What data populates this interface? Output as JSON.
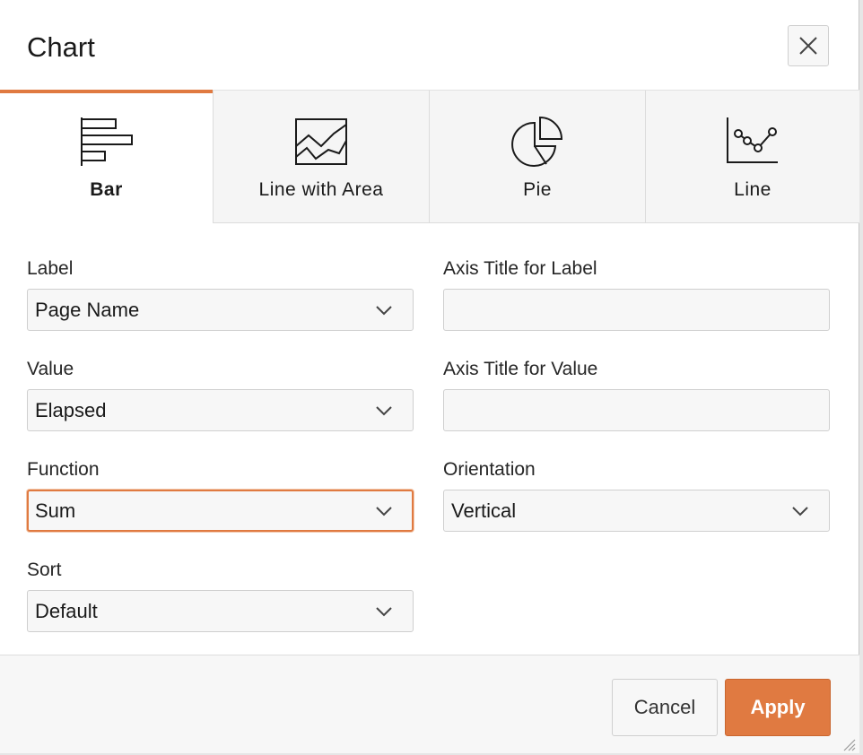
{
  "dialog": {
    "title": "Chart"
  },
  "tabs": [
    {
      "label": "Bar",
      "icon": "bar-chart-icon",
      "active": true
    },
    {
      "label": "Line with Area",
      "icon": "area-chart-icon",
      "active": false
    },
    {
      "label": "Pie",
      "icon": "pie-chart-icon",
      "active": false
    },
    {
      "label": "Line",
      "icon": "line-chart-icon",
      "active": false
    }
  ],
  "form": {
    "label": {
      "label": "Label",
      "value": "Page Name"
    },
    "axis_title_label": {
      "label": "Axis Title for Label",
      "value": ""
    },
    "value": {
      "label": "Value",
      "value": "Elapsed"
    },
    "axis_title_value": {
      "label": "Axis Title for Value",
      "value": ""
    },
    "function": {
      "label": "Function",
      "value": "Sum"
    },
    "orientation": {
      "label": "Orientation",
      "value": "Vertical"
    },
    "sort": {
      "label": "Sort",
      "value": "Default"
    }
  },
  "footer": {
    "cancel_label": "Cancel",
    "apply_label": "Apply"
  },
  "colors": {
    "accent": "#e07a41",
    "focus_border": "#e07a41",
    "apply_bg": "#e07a41"
  }
}
